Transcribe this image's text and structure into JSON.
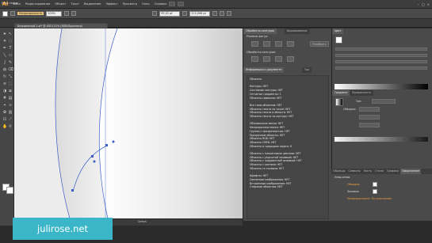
{
  "app": {
    "logo": "Ai"
  },
  "menu": [
    "Файл",
    "Редактирование",
    "Объект",
    "Текст",
    "Выделение",
    "Эффект",
    "Просмотр",
    "Окно",
    "Справка"
  ],
  "control_bar": {
    "mode_label": "Непрозрачность",
    "opacity_value": "100%",
    "stroke_value": "95,02 pt",
    "coord_value": "215,098 pt",
    "stroke_label": "Обводка"
  },
  "anchor_label": "Узлы сетки",
  "doc_tab": "Безымянный-1.ai* @ 4815,51% (RGB/Просмотр)",
  "status": {
    "zoom": "4815,51%",
    "text": "Сетка"
  },
  "watermark": "julirose.net",
  "mid_panel": {
    "tabs": [
      "Обработка контуров",
      "Выравнивание"
    ],
    "shape_modes_label": "Режимы фигур:",
    "pathfinder_label": "Обработка контуров:",
    "expand_button": "Разобрать",
    "info_tabs": [
      "Информация о документе",
      "Тра"
    ],
    "info_lines": [
      "Объекты",
      "",
      "Контуры: НЕТ",
      "Составные контуры: НЕТ",
      "Сетчатые градиенты: 1",
      "Объекты символов: НЕТ",
      "",
      "Все типы объектов: НЕТ",
      "Объекты текста по точке: НЕТ",
      "Объекты текста в области: НЕТ",
      "Объекты текста по контуру: НЕТ",
      "",
      "Обтравочные маски: НЕТ",
      "Непрозрачные маски: НЕТ",
      "Группы с прозрачностью: НЕТ",
      "Прозрачные объекты: НЕТ",
      "Объекты RGB: НЕТ",
      "Объекты CMYK: НЕТ",
      "Объекты в градациях серого: 6",
      "",
      "Объекты с плашечными цветами: НЕТ",
      "Объекты с узорчатой заливкой: НЕТ",
      "Объекты с градиентной заливкой: НЕТ",
      "Объекты с кистями: НЕТ",
      "Объекты со стилями: НЕТ",
      "",
      "Шрифты: НЕТ",
      "Связанные изображения: НЕТ",
      "Встроенные изображения: НЕТ",
      "Стирание объектов: НЕТ"
    ]
  },
  "right_panel": {
    "color_tab": "Цвет",
    "gradient_tabs": [
      "Градиент",
      "Прозрачность"
    ],
    "type_label": "Тип:",
    "stroke_label": "Обводка:",
    "appearance_tabs": [
      "Образцы",
      "Символы",
      "Кисть",
      "Стили",
      "Графика",
      "Оформление"
    ],
    "appearance_title": "Узлы сетки",
    "appearance_rows": [
      "Обводка:",
      "Заливка:",
      "Непрозрачность: По умолчанию"
    ]
  },
  "colors": {
    "accent": "#f3a13f",
    "canvas": "#ffffff",
    "panel": "#4a4a4a",
    "watermark": "#3ab6c8"
  }
}
